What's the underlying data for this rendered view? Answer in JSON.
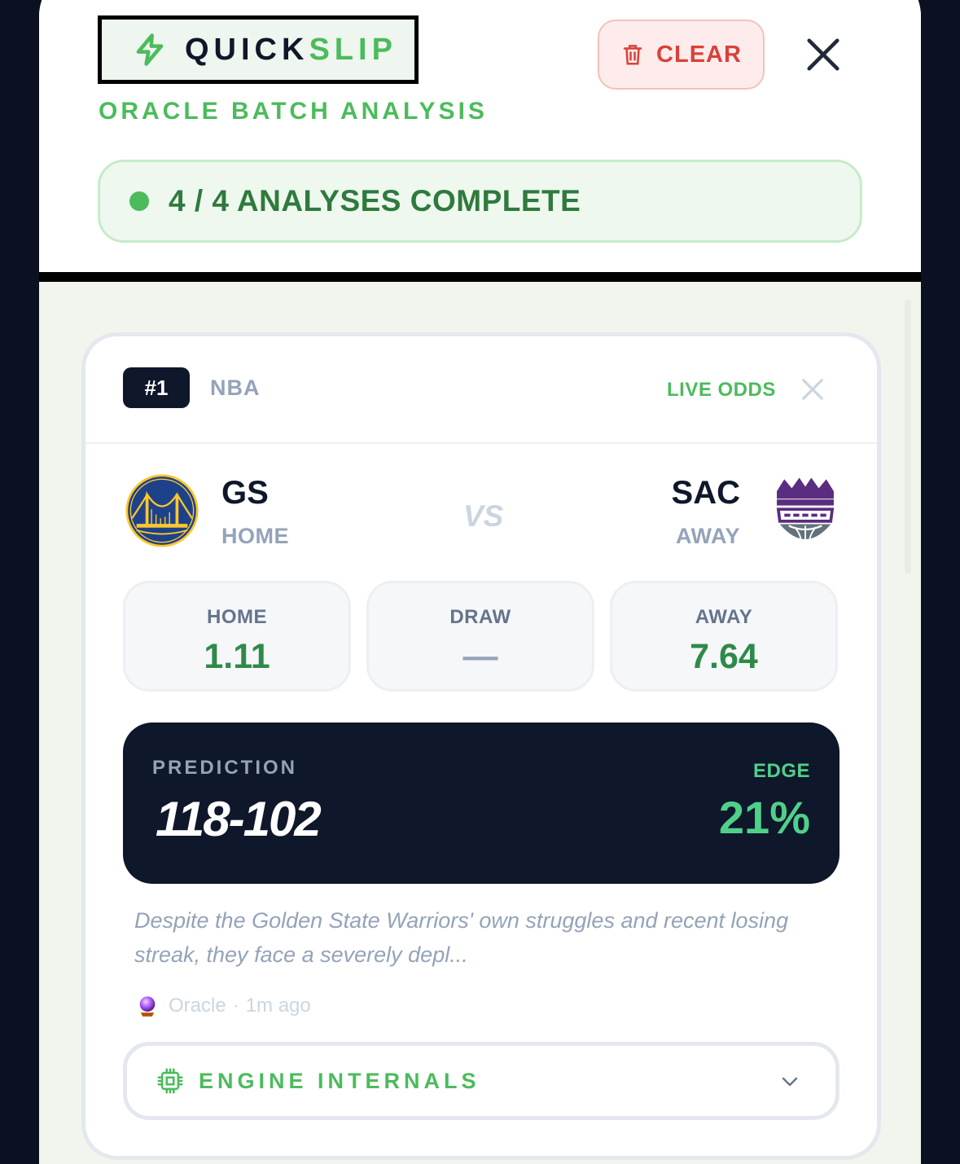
{
  "header": {
    "brand_part1": "QUICK",
    "brand_part2": "SLIP",
    "clear_label": "CLEAR",
    "subtitle": "ORACLE BATCH ANALYSIS",
    "status_text": "4 / 4 ANALYSES COMPLETE"
  },
  "card": {
    "rank": "#1",
    "league": "NBA",
    "live_label": "LIVE ODDS",
    "home": {
      "code": "GS",
      "side": "HOME"
    },
    "away": {
      "code": "SAC",
      "side": "AWAY"
    },
    "vs": "VS",
    "odds": [
      {
        "label": "HOME",
        "value": "1.11"
      },
      {
        "label": "DRAW",
        "value": "—"
      },
      {
        "label": "AWAY",
        "value": "7.64"
      }
    ],
    "prediction_label": "PREDICTION",
    "prediction_value": "118-102",
    "edge_label": "EDGE",
    "edge_value": "21%",
    "summary": "Despite the Golden State Warriors' own struggles and recent losing streak, they face a severely depl...",
    "meta_author": "Oracle",
    "meta_sep": "·",
    "meta_time": "1m ago",
    "engine_label": "ENGINE INTERNALS"
  },
  "colors": {
    "accent_green": "#4cbb5c",
    "danger_red": "#d8413a",
    "dark_navy": "#0f172a"
  },
  "icons": {
    "brand": "lightning-icon",
    "clear": "trash-icon",
    "close": "close-icon",
    "home_team": "warriors-logo",
    "away_team": "kings-logo",
    "oracle": "crystal-ball-icon",
    "engine": "chip-icon",
    "expand": "chevron-down-icon"
  }
}
